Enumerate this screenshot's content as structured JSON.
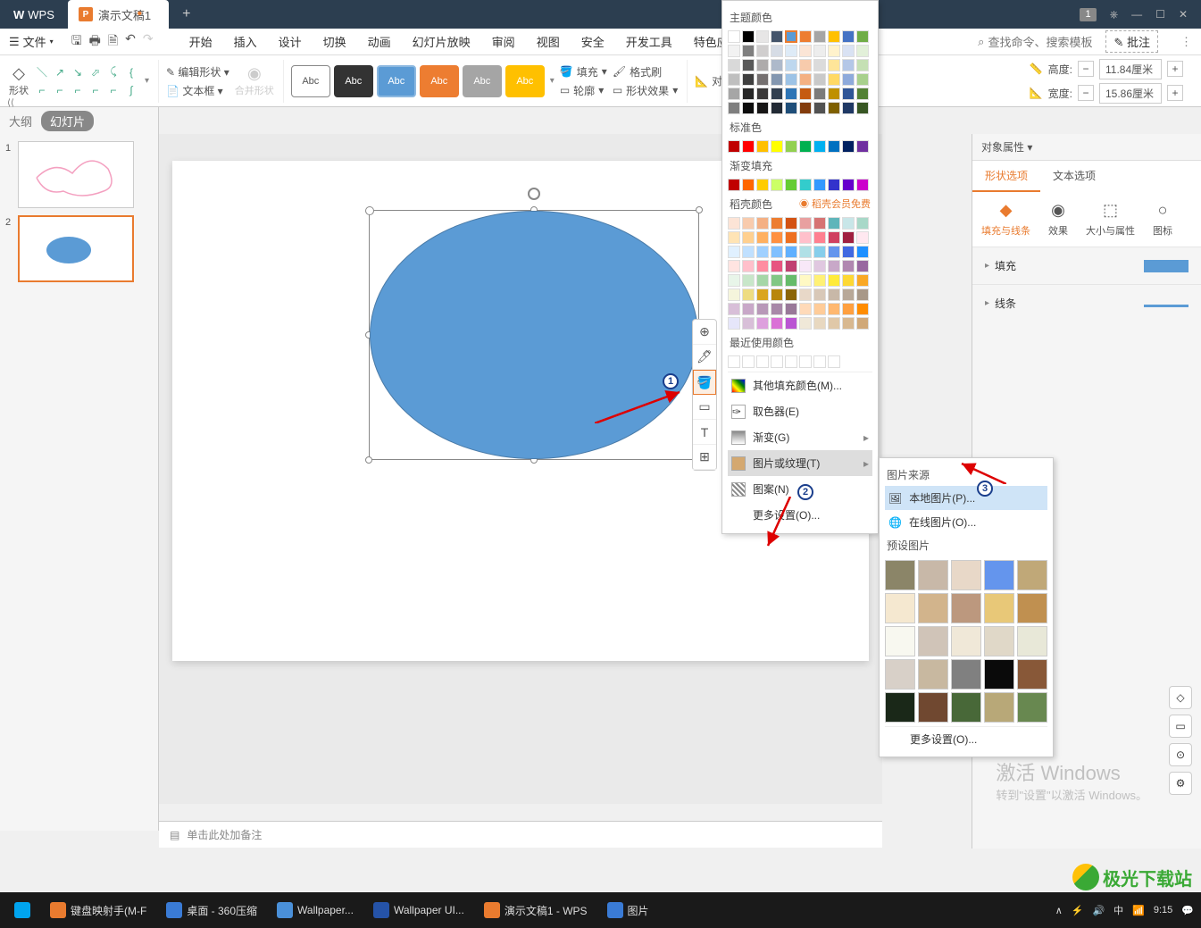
{
  "titlebar": {
    "app": "WPS",
    "doc": "演示文稿1",
    "badge": "1"
  },
  "menu": {
    "file": "文件",
    "tabs": [
      "开始",
      "插入",
      "设计",
      "切换",
      "动画",
      "幻灯片放映",
      "审阅",
      "视图",
      "安全",
      "开发工具",
      "特色应"
    ],
    "search_placeholder": "查找命令、搜索模板",
    "annotate": "批注"
  },
  "ribbon": {
    "shape": "形状",
    "edit_shape": "编辑形状",
    "textbox": "文本框",
    "merge": "合并形状",
    "style_label": "Abc",
    "fill": "填充",
    "outline": "轮廓",
    "effect": "形状效果",
    "format_painter": "格式刷",
    "align": "对齐",
    "height_label": "高度:",
    "width_label": "宽度:",
    "height_val": "11.84厘米",
    "width_val": "15.86厘米"
  },
  "left": {
    "outline": "大纲",
    "slide": "幻灯片"
  },
  "color_popup": {
    "theme": "主题颜色",
    "standard": "标准色",
    "gradient_fill": "渐变填充",
    "doc_color": "稻壳颜色",
    "vip": "稻壳会员免费",
    "recent": "最近使用颜色",
    "more_fill": "其他填充颜色(M)...",
    "eyedropper": "取色器(E)",
    "gradient": "渐变(G)",
    "texture": "图片或纹理(T)",
    "pattern": "图案(N)",
    "more": "更多设置(O)..."
  },
  "texture_popup": {
    "source": "图片来源",
    "local": "本地图片(P)...",
    "online": "在线图片(O)...",
    "preset": "预设图片",
    "more": "更多设置(O)..."
  },
  "right": {
    "title": "对象属性",
    "tab_shape": "形状选项",
    "tab_text": "文本选项",
    "tool_fill": "填充与线条",
    "tool_effect": "效果",
    "tool_size": "大小与属性",
    "tool_icon": "图标",
    "section_fill": "填充",
    "section_line": "线条"
  },
  "notes": "单击此处加备注",
  "activate": {
    "l1": "激活 Windows",
    "l2": "转到\"设置\"以激活 Windows。"
  },
  "watermark": "极光下载站",
  "taskbar": {
    "items": [
      "键盘映射手(M-F",
      "桌面 - 360压缩",
      "Wallpaper...",
      "Wallpaper UI...",
      "演示文稿1 - WPS",
      "图片"
    ],
    "time": "9:15"
  },
  "colors": {
    "theme_row": [
      "#ffffff",
      "#000000",
      "#e7e6e6",
      "#44546a",
      "#5b9bd5",
      "#ed7d31",
      "#a5a5a5",
      "#ffc000",
      "#4472c4",
      "#70ad47"
    ],
    "theme_grid": [
      [
        "#f2f2f2",
        "#7f7f7f",
        "#d0cece",
        "#d6dce5",
        "#deebf7",
        "#fbe5d6",
        "#ededed",
        "#fff2cc",
        "#d9e2f3",
        "#e2f0d9"
      ],
      [
        "#d9d9d9",
        "#595959",
        "#aeabab",
        "#adb9ca",
        "#bdd7ee",
        "#f7cbac",
        "#dbdbdb",
        "#fee599",
        "#b4c7e7",
        "#c5e0b4"
      ],
      [
        "#bfbfbf",
        "#3f3f3f",
        "#757070",
        "#8497b0",
        "#9dc3e6",
        "#f4b183",
        "#c9c9c9",
        "#ffd965",
        "#8eaadb",
        "#a8d08d"
      ],
      [
        "#a6a6a6",
        "#262626",
        "#3a3838",
        "#323f4f",
        "#2e75b6",
        "#c55a11",
        "#7b7b7b",
        "#bf9000",
        "#2f5597",
        "#538135"
      ],
      [
        "#7f7f7f",
        "#0d0d0d",
        "#171616",
        "#222a35",
        "#1f4e79",
        "#833c0c",
        "#525252",
        "#7f6000",
        "#1f3864",
        "#375623"
      ]
    ],
    "standard": [
      "#c00000",
      "#ff0000",
      "#ffc000",
      "#ffff00",
      "#92d050",
      "#00b050",
      "#00b0f0",
      "#0070c0",
      "#002060",
      "#7030a0"
    ],
    "gradient": [
      "#c00000",
      "#ff6600",
      "#ffcc00",
      "#ccff66",
      "#66cc33",
      "#33cccc",
      "#3399ff",
      "#3333cc",
      "#6600cc",
      "#cc00cc"
    ],
    "doc": [
      [
        "#fce4d6",
        "#f8cbad",
        "#f4b084",
        "#ed7d31",
        "#d35213",
        "#e8a0a0",
        "#d67373",
        "#5FB5BA",
        "#C8E6E8",
        "#A8D8C8"
      ],
      [
        "#FFE4B5",
        "#FFD090",
        "#FFB060",
        "#FF9040",
        "#EE7020",
        "#FFC0CB",
        "#FF8090",
        "#D04060",
        "#A02040",
        "#FFE8F0"
      ],
      [
        "#E0F0FF",
        "#C0E0FF",
        "#A0D0FF",
        "#80C0FF",
        "#60B0FF",
        "#B0E0E6",
        "#87CEEB",
        "#6495ED",
        "#4169E1",
        "#1E90FF"
      ],
      [
        "#FFE4E1",
        "#FFC0CB",
        "#FF8DA1",
        "#E75480",
        "#C04070",
        "#F8E8F8",
        "#E0C8E0",
        "#C8A8C8",
        "#B088B0",
        "#9868A0"
      ],
      [
        "#E8F5E9",
        "#C8E6C9",
        "#A5D6A7",
        "#81C784",
        "#66BB6A",
        "#FFF9C4",
        "#FFF176",
        "#FFEB3B",
        "#FDD835",
        "#F9A825"
      ],
      [
        "#F5F5DC",
        "#EEDC82",
        "#DAA520",
        "#B8860B",
        "#8B6508",
        "#E8D8C8",
        "#D8C8B8",
        "#C8B8A8",
        "#B8A898",
        "#A89888"
      ],
      [
        "#D8BFD8",
        "#C8A8C8",
        "#B898B8",
        "#A888A8",
        "#987898",
        "#FFDAB9",
        "#FFCC99",
        "#FFB870",
        "#FFA040",
        "#FF8C00"
      ],
      [
        "#E6E6FA",
        "#D8BFD8",
        "#DDA0DD",
        "#DA70D6",
        "#BA55D3",
        "#F0E8D8",
        "#E8D8C0",
        "#E0C8A8",
        "#D8B890",
        "#D0A878"
      ]
    ],
    "recent": [
      "#ffffff",
      "#ffffff",
      "#ffffff",
      "#ffffff",
      "#ffffff",
      "#ffffff",
      "#ffffff",
      "#ffffff"
    ],
    "textures": [
      [
        "#8B8568",
        "#C8B8A8",
        "#E8D8C8",
        "#6495ED",
        "#C0A878"
      ],
      [
        "#F5E8D0",
        "#D2B48C",
        "#BC987E",
        "#E8C878",
        "#C09050"
      ],
      [
        "#F8F8F0",
        "#D0C4B8",
        "#F0E8D8",
        "#E0D8C8",
        "#E8E8D8"
      ],
      [
        "#D8D0C8",
        "#C8B8A0",
        "#808080",
        "#0a0a0a",
        "#885838"
      ],
      [
        "#1a2818",
        "#704830",
        "#486838",
        "#B8A878",
        "#688850"
      ]
    ]
  }
}
